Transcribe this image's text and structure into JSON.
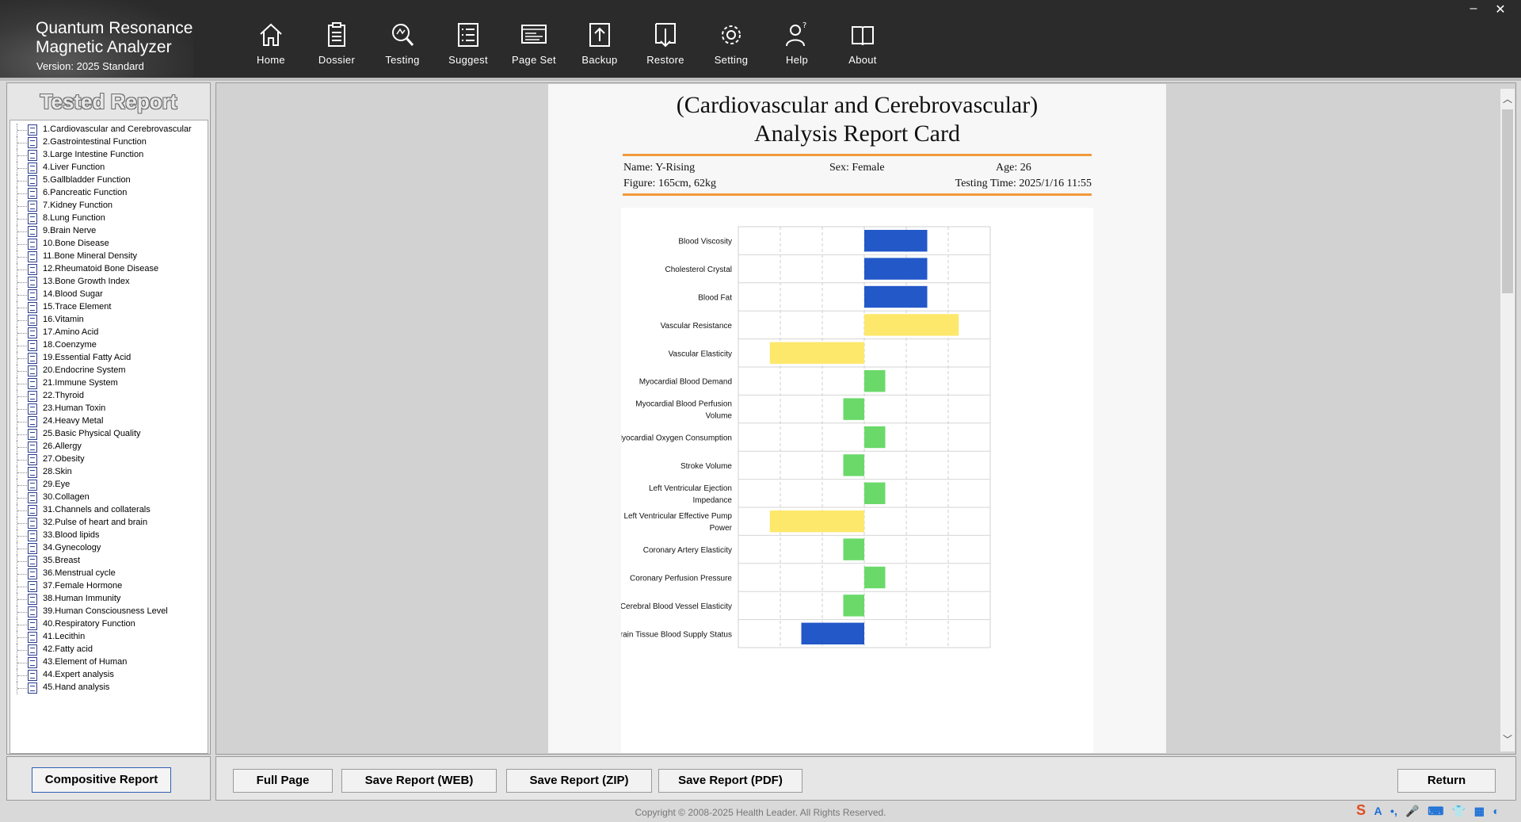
{
  "app": {
    "title_line1": "Quantum Resonance",
    "title_line2": "Magnetic Analyzer",
    "version": "Version: 2025 Standard"
  },
  "nav": [
    {
      "label": "Home",
      "icon": "home-icon"
    },
    {
      "label": "Dossier",
      "icon": "clipboard-icon"
    },
    {
      "label": "Testing",
      "icon": "magnifier-icon"
    },
    {
      "label": "Suggest",
      "icon": "list-icon"
    },
    {
      "label": "Page Set",
      "icon": "page-layout-icon"
    },
    {
      "label": "Backup",
      "icon": "upload-icon"
    },
    {
      "label": "Restore",
      "icon": "download-icon"
    },
    {
      "label": "Setting",
      "icon": "gear-icon"
    },
    {
      "label": "Help",
      "icon": "help-person-icon"
    },
    {
      "label": "About",
      "icon": "book-icon"
    }
  ],
  "window_controls": {
    "minimize": "–",
    "close": "✕"
  },
  "sidebar": {
    "title": "Tested Report",
    "items": [
      "1.Cardiovascular and Cerebrovascular",
      "2.Gastrointestinal Function",
      "3.Large Intestine Function",
      "4.Liver Function",
      "5.Gallbladder Function",
      "6.Pancreatic Function",
      "7.Kidney Function",
      "8.Lung Function",
      "9.Brain Nerve",
      "10.Bone Disease",
      "11.Bone Mineral Density",
      "12.Rheumatoid Bone Disease",
      "13.Bone Growth Index",
      "14.Blood Sugar",
      "15.Trace Element",
      "16.Vitamin",
      "17.Amino Acid",
      "18.Coenzyme",
      "19.Essential Fatty Acid",
      "20.Endocrine System",
      "21.Immune System",
      "22.Thyroid",
      "23.Human Toxin",
      "24.Heavy Metal",
      "25.Basic Physical Quality",
      "26.Allergy",
      "27.Obesity",
      "28.Skin",
      "29.Eye",
      "30.Collagen",
      "31.Channels and collaterals",
      "32.Pulse of heart and brain",
      "33.Blood lipids",
      "34.Gynecology",
      "35.Breast",
      "36.Menstrual cycle",
      "37.Female Hormone",
      "38.Human Immunity",
      "39.Human Consciousness Level",
      "40.Respiratory Function",
      "41.Lecithin",
      "42.Fatty acid",
      "43.Element of Human",
      "44.Expert analysis",
      "45.Hand analysis"
    ],
    "composite_button": "Compositive Report"
  },
  "report": {
    "title_line1": "(Cardiovascular and Cerebrovascular)",
    "title_line2": "Analysis Report Card",
    "name": "Name: Y-Rising",
    "sex": "Sex: Female",
    "age": "Age: 26",
    "figure": "Figure: 165cm, 62kg",
    "testing_time": "Testing Time: 2025/1/16 11:55"
  },
  "chart_data": {
    "type": "bar",
    "orientation": "horizontal",
    "baseline": 0,
    "xlim": [
      -3,
      3
    ],
    "grid": true,
    "categories": [
      [
        "Blood Viscosity"
      ],
      [
        "Cholesterol Crystal"
      ],
      [
        "Blood Fat"
      ],
      [
        "Vascular Resistance"
      ],
      [
        "Vascular Elasticity"
      ],
      [
        "Myocardial Blood Demand"
      ],
      [
        "Myocardial Blood Perfusion",
        "Volume"
      ],
      [
        "Myocardial Oxygen Consumption"
      ],
      [
        "Stroke Volume"
      ],
      [
        "Left Ventricular Ejection",
        "Impedance"
      ],
      [
        "Left Ventricular Effective Pump",
        "Power"
      ],
      [
        "Coronary Artery Elasticity"
      ],
      [
        "Coronary Perfusion Pressure"
      ],
      [
        "Cerebral Blood Vessel Elasticity"
      ],
      [
        "Brain Tissue Blood Supply Status"
      ]
    ],
    "values": [
      1.5,
      1.5,
      1.5,
      2.25,
      -2.25,
      0.5,
      -0.5,
      0.5,
      -0.5,
      0.5,
      -2.25,
      -0.5,
      0.5,
      -0.5,
      -1.5
    ],
    "bar_colors": [
      "#2358c8",
      "#2358c8",
      "#2358c8",
      "#fde86b",
      "#fde86b",
      "#6ad96a",
      "#6ad96a",
      "#6ad96a",
      "#6ad96a",
      "#6ad96a",
      "#fde86b",
      "#6ad96a",
      "#6ad96a",
      "#6ad96a",
      "#2358c8"
    ]
  },
  "buttons": {
    "full_page": "Full Page",
    "save_web": "Save Report (WEB)",
    "save_zip": "Save Report (ZIP)",
    "save_pdf": "Save Report (PDF)",
    "return": "Return"
  },
  "footer": {
    "copyright": "Copyright © 2008-2025 Health Leader. All Rights Reserved."
  },
  "ime_toolbar": [
    "S",
    "A",
    "•,",
    "🎤",
    "⌨",
    "👕",
    "▦",
    "◐"
  ]
}
